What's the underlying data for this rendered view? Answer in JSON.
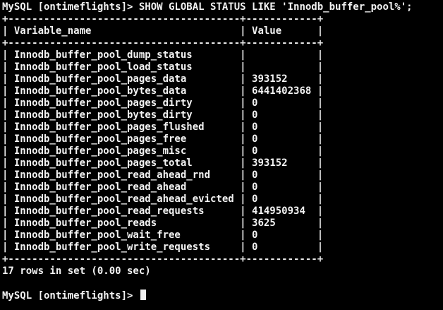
{
  "terminal": {
    "prompt": "MySQL [ontimeflights]> ",
    "command": "SHOW GLOBAL STATUS LIKE 'Innodb_buffer_pool%';",
    "headers": [
      "Variable_name",
      "Value"
    ],
    "rows": [
      {
        "name": "Innodb_buffer_pool_dump_status",
        "value": ""
      },
      {
        "name": "Innodb_buffer_pool_load_status",
        "value": ""
      },
      {
        "name": "Innodb_buffer_pool_pages_data",
        "value": "393152"
      },
      {
        "name": "Innodb_buffer_pool_bytes_data",
        "value": "6441402368"
      },
      {
        "name": "Innodb_buffer_pool_pages_dirty",
        "value": "0"
      },
      {
        "name": "Innodb_buffer_pool_bytes_dirty",
        "value": "0"
      },
      {
        "name": "Innodb_buffer_pool_pages_flushed",
        "value": "0"
      },
      {
        "name": "Innodb_buffer_pool_pages_free",
        "value": "0"
      },
      {
        "name": "Innodb_buffer_pool_pages_misc",
        "value": "0"
      },
      {
        "name": "Innodb_buffer_pool_pages_total",
        "value": "393152"
      },
      {
        "name": "Innodb_buffer_pool_read_ahead_rnd",
        "value": "0"
      },
      {
        "name": "Innodb_buffer_pool_read_ahead",
        "value": "0"
      },
      {
        "name": "Innodb_buffer_pool_read_ahead_evicted",
        "value": "0"
      },
      {
        "name": "Innodb_buffer_pool_read_requests",
        "value": "414950934"
      },
      {
        "name": "Innodb_buffer_pool_reads",
        "value": "3625"
      },
      {
        "name": "Innodb_buffer_pool_wait_free",
        "value": "0"
      },
      {
        "name": "Innodb_buffer_pool_write_requests",
        "value": "0"
      }
    ],
    "summary": "17 rows in set (0.00 sec)",
    "next_prompt": "MySQL [ontimeflights]> "
  },
  "colors": {
    "background": "#000000",
    "foreground": "#f2f2f2"
  }
}
